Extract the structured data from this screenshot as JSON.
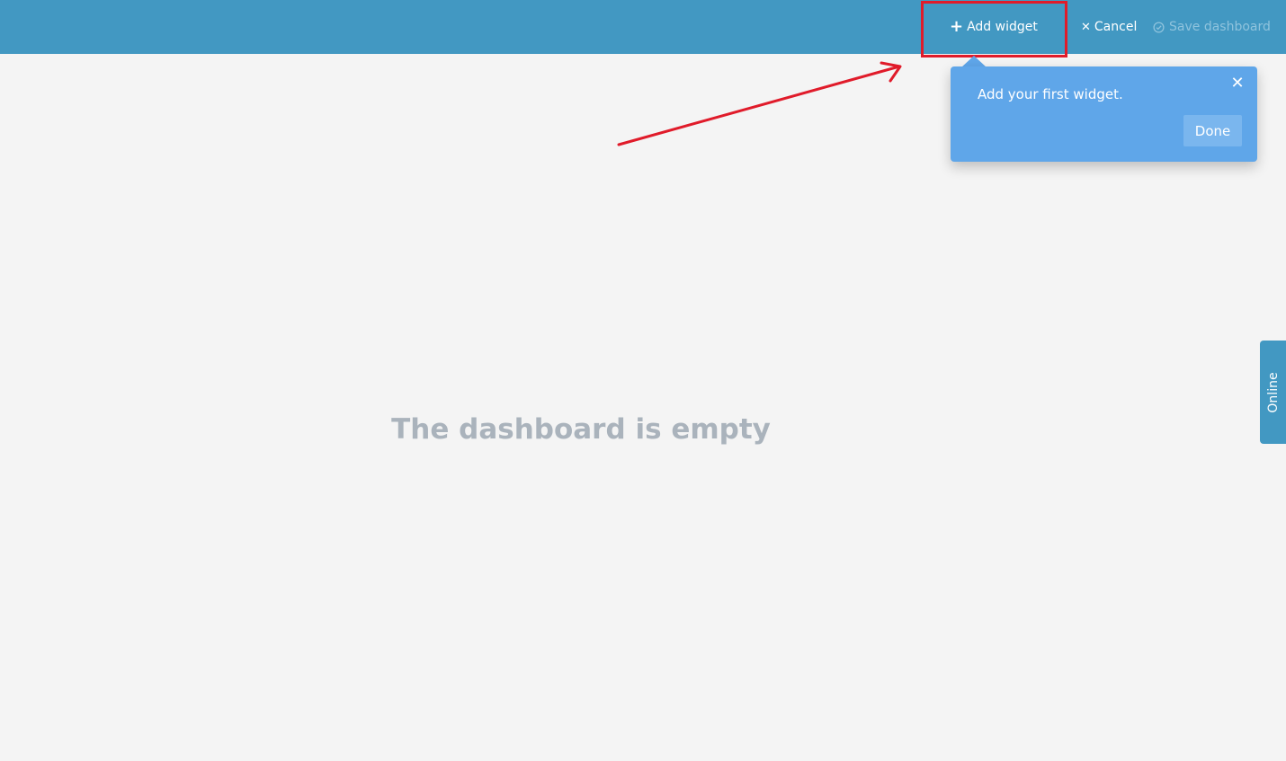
{
  "toolbar": {
    "add_widget_label": "Add widget",
    "cancel_label": "Cancel",
    "save_label": "Save dashboard"
  },
  "tooltip": {
    "message": "Add your first widget.",
    "done_label": "Done"
  },
  "main": {
    "empty_message": "The dashboard is empty"
  },
  "side_tab": {
    "label": "Online"
  },
  "icons": {
    "add": "plus-icon",
    "cancel": "close-icon",
    "save": "check-circle-icon",
    "tooltip_close": "close-icon"
  },
  "colors": {
    "topbar": "#4298c2",
    "tooltip": "#5fa6e9",
    "tooltip_button": "#7ab6ee",
    "annotation": "#e01b2a",
    "empty_text": "#aab3bc",
    "save_disabled": "#8fc3dd"
  }
}
